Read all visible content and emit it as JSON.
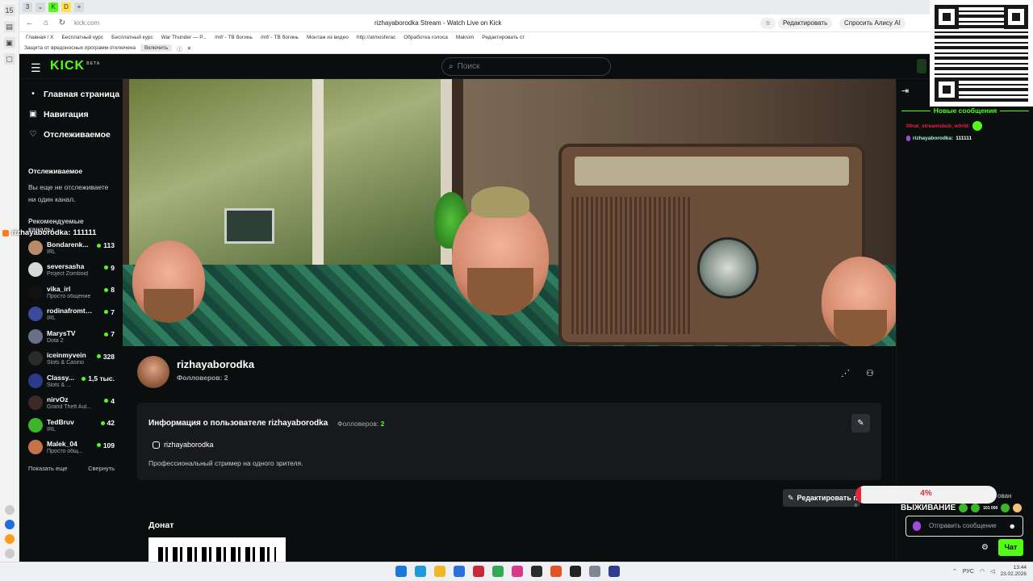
{
  "browser": {
    "tab_count": "15",
    "url": "kick.com",
    "page_title": "rizhayaborodka Stream - Watch Live on Kick",
    "edit_label": "Редактировать",
    "alice_label": "Спросить Алису AI",
    "bookmarks": [
      "Главная / X",
      "Бесплатный курс",
      "Бесплатный курс",
      "War Thunder — Р...",
      "/mf/ - ТВ богинь",
      "/mf/ - ТВ богинь",
      "Монтаж из видео",
      "http://atmosferac",
      "Обработка голоса",
      "Maksim",
      "Редактировать ст"
    ],
    "warning_text": "Защита от вредоносных программ отключена",
    "warning_button": "Включить"
  },
  "header": {
    "logo": "KICK",
    "logo_sup": "BETA",
    "search_placeholder": "Поиск"
  },
  "sidebar": {
    "nav": [
      {
        "label": "Главная страница",
        "icon": "home-icon"
      },
      {
        "label": "Навигация",
        "icon": "compass-icon"
      },
      {
        "label": "Отслеживаемое",
        "icon": "heart-icon"
      }
    ],
    "following_title": "Отслеживаемое",
    "following_empty": "Вы еще не отслеживаете ни один канал.",
    "recommended_title": "Рекомендуемые каналы",
    "channels": [
      {
        "name": "Bondarenk...",
        "category": "IRL",
        "viewers": "113",
        "color": "#b78a6a"
      },
      {
        "name": "seversasha",
        "category": "Project Zomboid",
        "viewers": "9",
        "color": "#d9d9d9"
      },
      {
        "name": "vika_irl",
        "category": "Просто общение",
        "viewers": "8",
        "color": "#111111"
      },
      {
        "name": "rodinafromthai",
        "category": "IRL",
        "viewers": "7",
        "color": "#3b4a9a"
      },
      {
        "name": "MarysTV",
        "category": "Dota 2",
        "viewers": "7",
        "color": "#6a6f8a"
      },
      {
        "name": "iceinmyvein",
        "category": "Slots & Casino",
        "viewers": "328",
        "color": "#2a2a2a"
      },
      {
        "name": "Classy...",
        "category": "Slots & ...",
        "viewers": "1,5 тыс.",
        "color": "#2b3a8c"
      },
      {
        "name": "nirvOz",
        "category": "Grand Theft Aut...",
        "viewers": "4",
        "color": "#3a2a2a"
      },
      {
        "name": "TedBruv",
        "category": "IRL",
        "viewers": "42",
        "color": "#3cb52a"
      },
      {
        "name": "Malek_04",
        "category": "Просто общ...",
        "viewers": "109",
        "color": "#c7734a"
      }
    ],
    "show_more": "Показать еще",
    "collapse": "Свернуть"
  },
  "overlay": {
    "user": "rizhayaborodka:",
    "message": "111111"
  },
  "profile": {
    "name": "rizhayaborodka",
    "followers_line": "Фолловеров: 2"
  },
  "info": {
    "title": "Информация о пользователе rizhayaborodka",
    "followers_label": "Фолловеров:",
    "followers_value": "2",
    "instagram": "rizhayaborodka",
    "description": "Профессиональный стример на одного зрителя."
  },
  "edit_panels": "Редактировать панели",
  "donate": {
    "title": "Донат"
  },
  "chat": {
    "new_messages": "Новые сообщения",
    "messages": [
      {
        "user": "00rat_streamsbub_w0rld:",
        "text": "",
        "user_color": "#e5263a",
        "has_emote": true
      },
      {
        "user": "rizhayaborodka:",
        "text": "111111",
        "user_color": "#9cffd0",
        "has_emote": false
      }
    ],
    "input_placeholder": "Отправить сообщение",
    "send": "Чат",
    "banned_partial": "ован"
  },
  "survival": {
    "progress": 4,
    "progress_label": "4%",
    "min_label": "0",
    "title": "ВЫЖИВАНИЕ",
    "count_label": "101 000"
  },
  "taskbar": {
    "lang": "РУС",
    "time": "13:44",
    "date": "23.02.2026"
  }
}
